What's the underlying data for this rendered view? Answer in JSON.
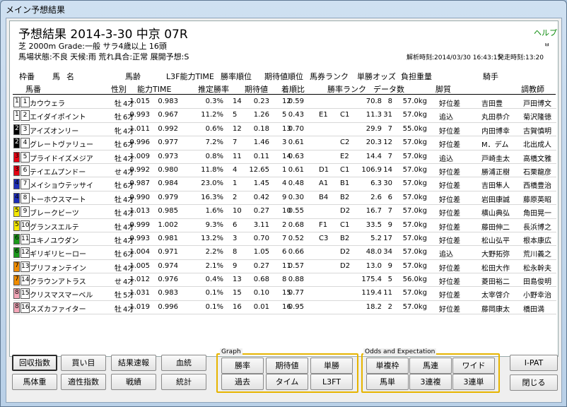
{
  "window": {
    "title": "メイン予想結果"
  },
  "header": {
    "title": "予想結果 2014-3-30 中京 07R",
    "help": "ヘルプ",
    "corner": "ㅂ",
    "line1": "芝 2000m  Grade:一般 サラ4歳以上  16頭",
    "line2": "馬場状態:不良  天候:雨  荒れ具合:正常  展開予想:S",
    "analysis_time": "解析時刻:2014/03/30 16:43:15",
    "post_time": "発走時刻:13:20"
  },
  "columns_top": {
    "waku": "枠番",
    "uma": "馬",
    "mei": "名",
    "barei": "馬齢",
    "l3f": "L3F能力TIME",
    "shoritsu_jun": "勝率順位",
    "kitai_jun": "期待値順位",
    "baken_rank": "馬券ランク",
    "tansho_odds": "単勝オッズ",
    "futan": "負担重量",
    "kishu": "騎手"
  },
  "columns": {
    "umaban": "馬番",
    "seibetsu": "性別",
    "noryoku": "能力TIME",
    "suitei": "推定勝率",
    "kitai": "期待値",
    "chakujun": "着順比",
    "shoritsu_rank": "勝率ランク",
    "data_count": "データ数",
    "kyakushitsu": "脚質",
    "chokyo": "調教師"
  },
  "frame_colors": {
    "1": "#ffffff",
    "2": "#000000",
    "3": "#e60012",
    "4": "#1d2db8",
    "5": "#f5e800",
    "6": "#1b9a1b",
    "7": "#f08c00",
    "8": "#f4a7b9"
  },
  "horses": [
    {
      "waku": "1",
      "num": "1",
      "name": "カウウェラ",
      "sex": "牡",
      "age": "4才",
      "ab": "1.015",
      "l3f": "0.983",
      "pct": "0.3%",
      "wr": "14",
      "ev": "0.23",
      "er": "12",
      "cr": "0.59",
      "br": "",
      "sr": "",
      "odds": "70.8",
      "dc": "8",
      "w": "57.0kg",
      "st": "好位差",
      "jk": "吉田豊",
      "tr": "戸田博文"
    },
    {
      "waku": "1",
      "num": "2",
      "name": "エイダイポイント",
      "sex": "牡",
      "age": "6才",
      "ab": "0.993",
      "l3f": "0.967",
      "pct": "11.2%",
      "wr": "5",
      "ev": "1.26",
      "er": "5",
      "cr": "0.43",
      "br": "E1",
      "sr": "C1",
      "odds": "11.3",
      "dc": "31",
      "w": "57.0kg",
      "st": "追込",
      "jk": "丸田恭介",
      "tr": "菊沢隆徳"
    },
    {
      "waku": "2",
      "num": "3",
      "name": "アイズオンリー",
      "sex": "牝",
      "age": "4才",
      "ab": "1.011",
      "l3f": "0.992",
      "pct": "0.6%",
      "wr": "12",
      "ev": "0.18",
      "er": "13",
      "cr": "0.70",
      "br": "",
      "sr": "",
      "odds": "29.9",
      "dc": "7",
      "w": "55.0kg",
      "st": "好位差",
      "jk": "内田博幸",
      "tr": "古賀慎明"
    },
    {
      "waku": "2",
      "num": "4",
      "name": "グレートヴァリュー",
      "sex": "牡",
      "age": "6才",
      "ab": "0.996",
      "l3f": "0.977",
      "pct": "7.2%",
      "wr": "7",
      "ev": "1.46",
      "er": "3",
      "cr": "0.61",
      "br": "",
      "sr": "C2",
      "odds": "20.3",
      "dc": "12",
      "w": "57.0kg",
      "st": "好位差",
      "jk": "M．デム",
      "tr": "北出成人"
    },
    {
      "waku": "3",
      "num": "5",
      "name": "プライドイズメジア",
      "sex": "牡",
      "age": "4才",
      "ab": "1.009",
      "l3f": "0.973",
      "pct": "0.8%",
      "wr": "11",
      "ev": "0.11",
      "er": "14",
      "cr": "0.63",
      "br": "",
      "sr": "E2",
      "odds": "14.4",
      "dc": "7",
      "w": "57.0kg",
      "st": "追込",
      "jk": "戸崎圭太",
      "tr": "高橋文雅"
    },
    {
      "waku": "3",
      "num": "6",
      "name": "テイエムプンドー",
      "sex": "せ",
      "age": "4才",
      "ab": "0.992",
      "l3f": "0.980",
      "pct": "11.8%",
      "wr": "4",
      "ev": "12.65",
      "er": "1",
      "cr": "0.61",
      "br": "D1",
      "sr": "C1",
      "odds": "106.9",
      "dc": "14",
      "w": "57.0kg",
      "st": "好位差",
      "jk": "勝浦正樹",
      "tr": "石栗龍彦"
    },
    {
      "waku": "4",
      "num": "7",
      "name": "メイショウテッサイ",
      "sex": "牡",
      "age": "6才",
      "ab": "0.987",
      "l3f": "0.984",
      "pct": "23.0%",
      "wr": "1",
      "ev": "1.45",
      "er": "4",
      "cr": "0.48",
      "br": "A1",
      "sr": "B1",
      "odds": "6.3",
      "dc": "30",
      "w": "57.0kg",
      "st": "好位差",
      "jk": "吉田隼人",
      "tr": "西橋豊治"
    },
    {
      "waku": "4",
      "num": "8",
      "name": "トーホウスマート",
      "sex": "牡",
      "age": "4才",
      "ab": "0.990",
      "l3f": "0.979",
      "pct": "16.3%",
      "wr": "2",
      "ev": "0.42",
      "er": "9",
      "cr": "0.30",
      "br": "B4",
      "sr": "B2",
      "odds": "2.6",
      "dc": "6",
      "w": "57.0kg",
      "st": "好位差",
      "jk": "岩田康誠",
      "tr": "藤原英昭"
    },
    {
      "waku": "5",
      "num": "9",
      "name": "ブレークビーツ",
      "sex": "牡",
      "age": "4才",
      "ab": "1.013",
      "l3f": "0.985",
      "pct": "1.6%",
      "wr": "10",
      "ev": "0.27",
      "er": "10",
      "cr": "0.55",
      "br": "",
      "sr": "D2",
      "odds": "16.7",
      "dc": "7",
      "w": "57.0kg",
      "st": "好位差",
      "jk": "横山典弘",
      "tr": "角田晃一"
    },
    {
      "waku": "5",
      "num": "10",
      "name": "グランスエルテ",
      "sex": "牡",
      "age": "4才",
      "ab": "0.999",
      "l3f": "1.002",
      "pct": "9.3%",
      "wr": "6",
      "ev": "3.11",
      "er": "2",
      "cr": "0.68",
      "br": "F1",
      "sr": "C1",
      "odds": "33.5",
      "dc": "9",
      "w": "57.0kg",
      "st": "好位差",
      "jk": "藤田伸二",
      "tr": "長浜博之"
    },
    {
      "waku": "6",
      "num": "11",
      "name": "ユキノユウダン",
      "sex": "牡",
      "age": "4才",
      "ab": "0.993",
      "l3f": "0.981",
      "pct": "13.2%",
      "wr": "3",
      "ev": "0.70",
      "er": "7",
      "cr": "0.52",
      "br": "C3",
      "sr": "B2",
      "odds": "5.2",
      "dc": "17",
      "w": "57.0kg",
      "st": "好位差",
      "jk": "松山弘平",
      "tr": "根本康広"
    },
    {
      "waku": "6",
      "num": "12",
      "name": "ギリギリヒーロー",
      "sex": "牡",
      "age": "6才",
      "ab": "1.004",
      "l3f": "0.971",
      "pct": "2.2%",
      "wr": "8",
      "ev": "1.05",
      "er": "6",
      "cr": "0.66",
      "br": "",
      "sr": "D2",
      "odds": "48.0",
      "dc": "34",
      "w": "57.0kg",
      "st": "追込",
      "jk": "大野拓弥",
      "tr": "荒川義之"
    },
    {
      "waku": "7",
      "num": "13",
      "name": "プリフォンテイン",
      "sex": "牡",
      "age": "4才",
      "ab": "1.005",
      "l3f": "0.974",
      "pct": "2.1%",
      "wr": "9",
      "ev": "0.27",
      "er": "11",
      "cr": "0.57",
      "br": "",
      "sr": "D2",
      "odds": "13.0",
      "dc": "9",
      "w": "57.0kg",
      "st": "好位差",
      "jk": "松田大作",
      "tr": "松永幹夫"
    },
    {
      "waku": "7",
      "num": "14",
      "name": "クラウンアトラス",
      "sex": "せ",
      "age": "4才",
      "ab": "1.012",
      "l3f": "0.976",
      "pct": "0.4%",
      "wr": "13",
      "ev": "0.68",
      "er": "8",
      "cr": "0.88",
      "br": "",
      "sr": "",
      "odds": "175.4",
      "dc": "5",
      "w": "56.0kg",
      "st": "好位差",
      "jk": "菱田裕二",
      "tr": "田島俊明"
    },
    {
      "waku": "8",
      "num": "15",
      "name": "クリスマスマーベル",
      "sex": "牡",
      "age": "5才",
      "ab": "1.031",
      "l3f": "0.983",
      "pct": "0.1%",
      "wr": "15",
      "ev": "0.10",
      "er": "15",
      "cr": "0.77",
      "br": "",
      "sr": "",
      "odds": "119.4",
      "dc": "11",
      "w": "57.0kg",
      "st": "好位差",
      "jk": "太宰啓介",
      "tr": "小野幸治"
    },
    {
      "waku": "8",
      "num": "16",
      "name": "スズカファイター",
      "sex": "牡",
      "age": "4才",
      "ab": "1.019",
      "l3f": "0.996",
      "pct": "0.1%",
      "wr": "16",
      "ev": "0.01",
      "er": "16",
      "cr": "0.95",
      "br": "",
      "sr": "",
      "odds": "18.2",
      "dc": "2",
      "w": "57.0kg",
      "st": "好位差",
      "jk": "藤岡康太",
      "tr": "橋田満"
    }
  ],
  "buttons": {
    "kaishu": "回収指数",
    "kaime": "買い目",
    "kekka": "結果速報",
    "ketto": "血統",
    "batai": "馬体重",
    "tekisei": "適性指数",
    "senseki": "戦績",
    "tokei": "統計",
    "ipat": "I-PAT",
    "close": "閉じる"
  },
  "graph": {
    "label": "Graph",
    "shoritsu": "勝率",
    "kitaichi": "期待値",
    "tansho": "単勝",
    "kako": "過去",
    "time": "タイム",
    "l3ft": "L3FT"
  },
  "odds": {
    "label": "Odds and Expectation",
    "wakuren": "単複枠",
    "umaren": "馬連",
    "wide": "ワイド",
    "umatan": "馬単",
    "sanrenpuku": "3連複",
    "sanrentan": "3連単"
  }
}
